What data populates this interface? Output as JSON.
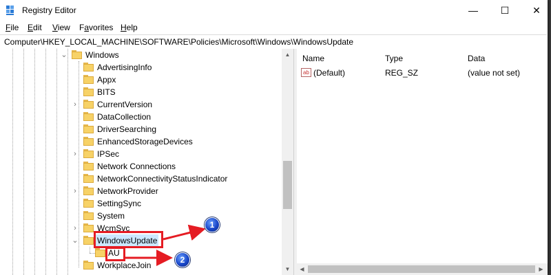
{
  "window": {
    "title": "Registry Editor",
    "controls": {
      "minimize": "—",
      "maximize": "☐",
      "close": "✕"
    }
  },
  "menu": {
    "items": [
      {
        "accel": "F",
        "rest": "ile"
      },
      {
        "accel": "E",
        "rest": "dit"
      },
      {
        "accel": "V",
        "rest": "iew"
      },
      {
        "pre": "F",
        "accel": "a",
        "rest": "vorites"
      },
      {
        "accel": "H",
        "rest": "elp"
      }
    ]
  },
  "address": {
    "path": "Computer\\HKEY_LOCAL_MACHINE\\SOFTWARE\\Policies\\Microsoft\\Windows\\WindowsUpdate"
  },
  "tree": {
    "parent": {
      "label": "Windows",
      "chevron": "⌄"
    },
    "children": [
      {
        "label": "AdvertisingInfo",
        "chevron": ""
      },
      {
        "label": "Appx",
        "chevron": ""
      },
      {
        "label": "BITS",
        "chevron": ""
      },
      {
        "label": "CurrentVersion",
        "chevron": "›"
      },
      {
        "label": "DataCollection",
        "chevron": ""
      },
      {
        "label": "DriverSearching",
        "chevron": ""
      },
      {
        "label": "EnhancedStorageDevices",
        "chevron": ""
      },
      {
        "label": "IPSec",
        "chevron": "›"
      },
      {
        "label": "Network Connections",
        "chevron": ""
      },
      {
        "label": "NetworkConnectivityStatusIndicator",
        "chevron": ""
      },
      {
        "label": "NetworkProvider",
        "chevron": "›"
      },
      {
        "label": "SettingSync",
        "chevron": ""
      },
      {
        "label": "System",
        "chevron": ""
      },
      {
        "label": "WcmSvc",
        "chevron": "›"
      },
      {
        "label": "WindowsUpdate",
        "chevron": "⌄"
      }
    ],
    "grandchild": {
      "label": "AU"
    },
    "last": {
      "label": "WorkplaceJoin"
    }
  },
  "values_pane": {
    "columns": [
      "Name",
      "Type",
      "Data"
    ],
    "rows": [
      {
        "icon_text": "ab",
        "name": "(Default)",
        "type": "REG_SZ",
        "data": "(value not set)"
      }
    ]
  },
  "annotations": [
    {
      "number": "1"
    },
    {
      "number": "2"
    }
  ],
  "colors": {
    "highlight": "#e51c23",
    "selection": "#cce8ff",
    "folder": "#f7d267"
  }
}
